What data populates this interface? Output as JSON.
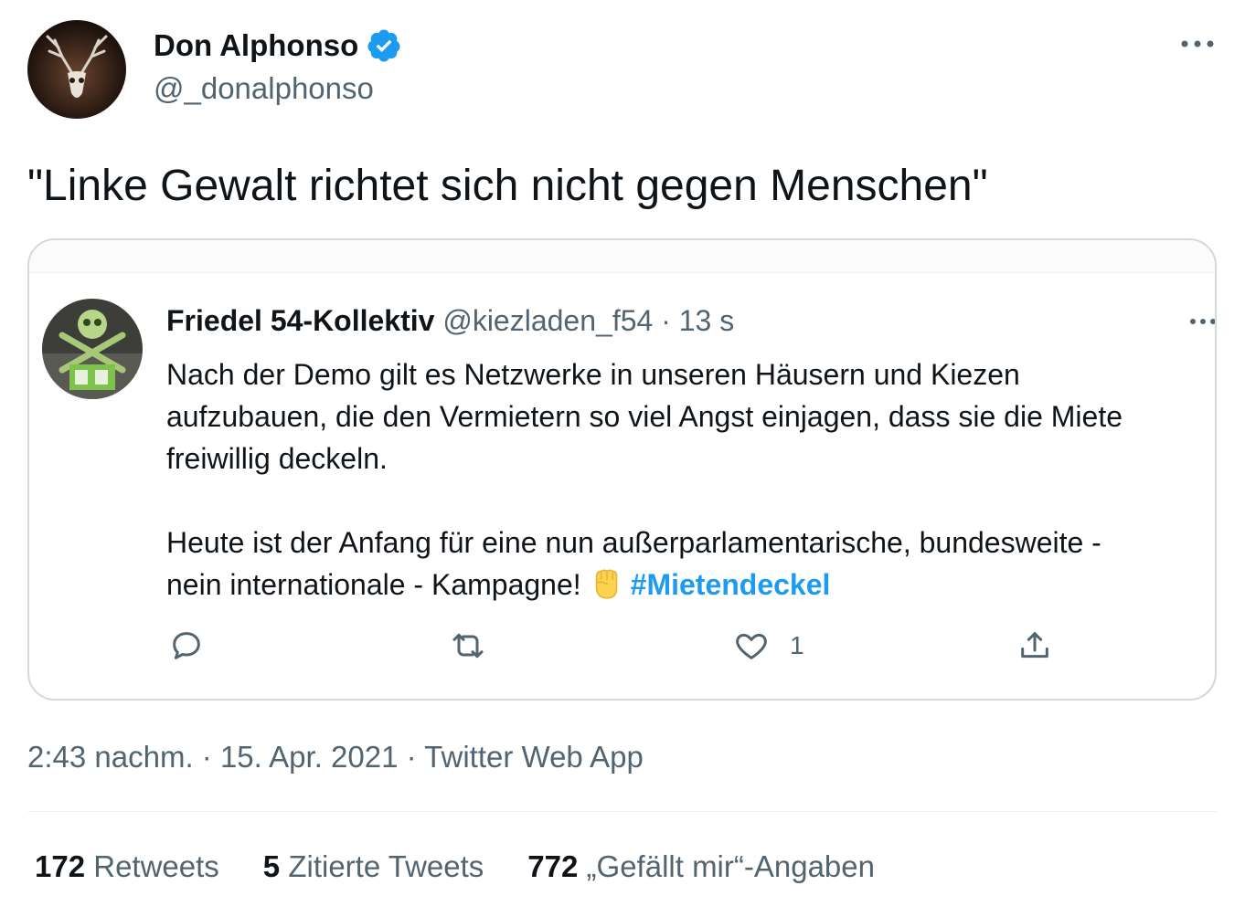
{
  "author": {
    "name": "Don Alphonso",
    "handle": "@_donalphonso",
    "verified": true,
    "verified_color": "#1d9bf0"
  },
  "tweet": {
    "text": "\"Linke Gewalt richtet sich nicht gegen Menschen\""
  },
  "embedded": {
    "name": "Friedel 54-Kollektiv",
    "handle": "@kiezladen_f54",
    "time": "· 13 s",
    "line1": "Nach der Demo gilt es Netzwerke in unseren Häusern und Kiezen",
    "line2": "aufzubauen, die den Vermietern so viel Angst einjagen, dass sie die Miete",
    "line3": "freiwillig deckeln.",
    "line4": "Heute ist der Anfang für eine nun außerparlamentarische, bundesweite -",
    "line5": "nein internationale - Kampagne!",
    "hashtag": "#Mietendeckel",
    "like_count": "1",
    "icons": [
      "reply-icon",
      "retweet-icon",
      "like-icon",
      "share-icon",
      "raised-fist-icon"
    ]
  },
  "meta": {
    "timestamp": "2:43 nachm. · 15. Apr. 2021 · Twitter Web App"
  },
  "stats": {
    "retweets_count": "172",
    "retweets_label": "Retweets",
    "quotes_count": "5",
    "quotes_label": "Zitierte Tweets",
    "likes_count": "772",
    "likes_label": "„Gefällt mir“-Angaben"
  },
  "colors": {
    "text": "#0f1419",
    "secondary": "#536471",
    "accent": "#1d9bf0",
    "border": "#cfd9de"
  }
}
